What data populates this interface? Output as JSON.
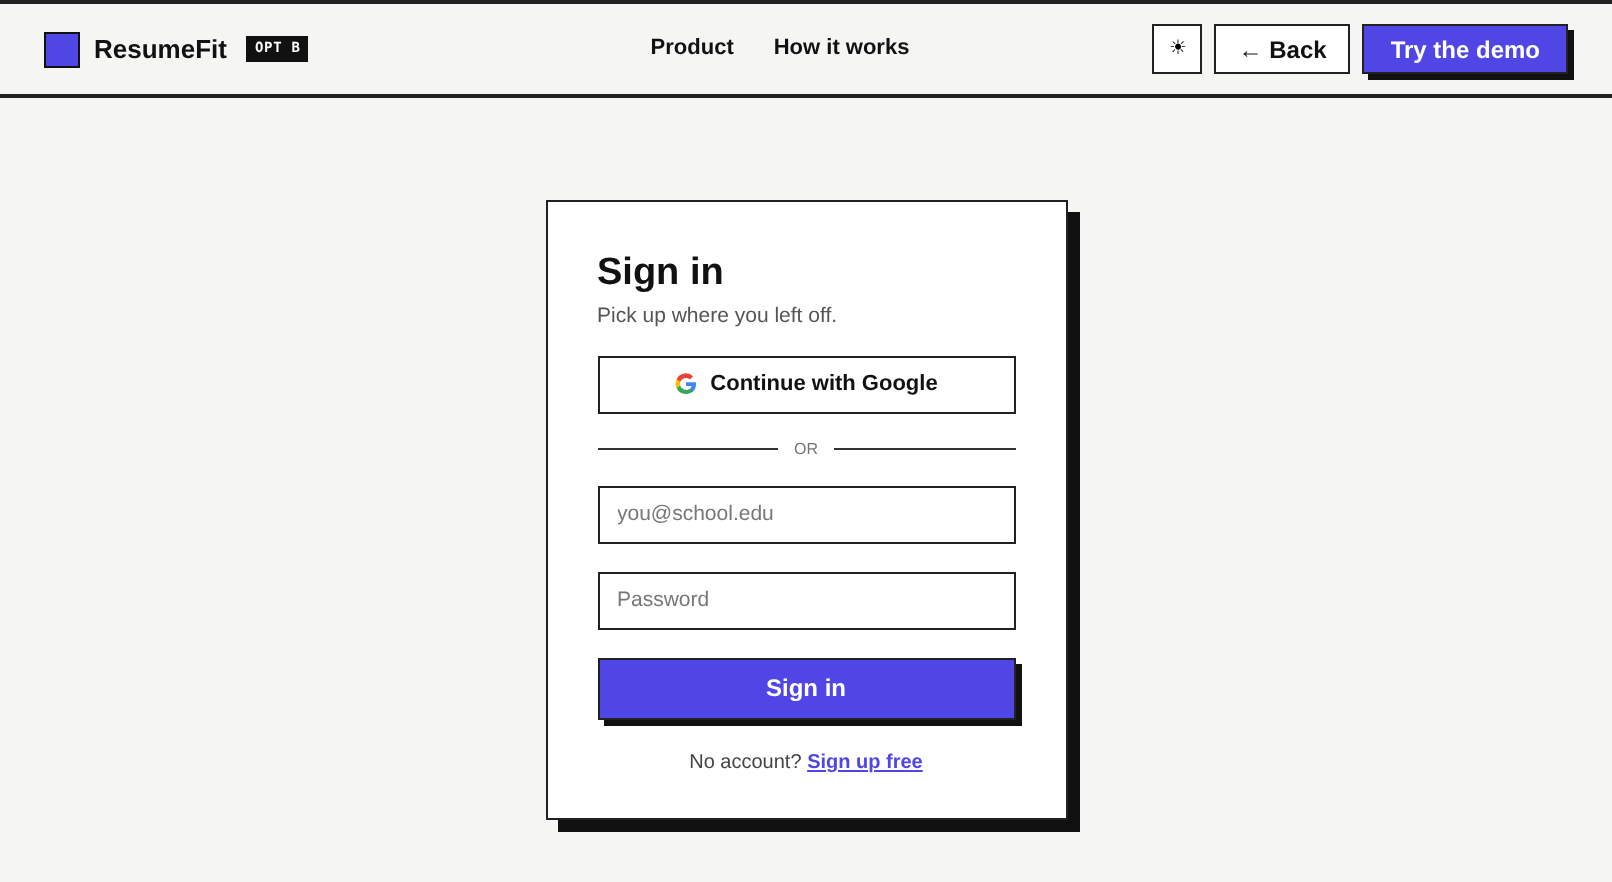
{
  "header": {
    "brand": "ResumeFit",
    "badge": "OPT B",
    "nav": [
      "Product",
      "How it works"
    ],
    "theme_toggle": "☀",
    "back_button": "← Back",
    "demo_button": "Try the demo"
  },
  "signin": {
    "title": "Sign in",
    "subtitle": "Pick up where you left off.",
    "google_button": "Continue with Google",
    "divider": "OR",
    "fields": [
      {
        "placeholder": "you@school.edu"
      },
      {
        "placeholder": "Password"
      }
    ],
    "submit": "Sign in",
    "footer_text": "No account?",
    "footer_link": "Sign up free"
  }
}
